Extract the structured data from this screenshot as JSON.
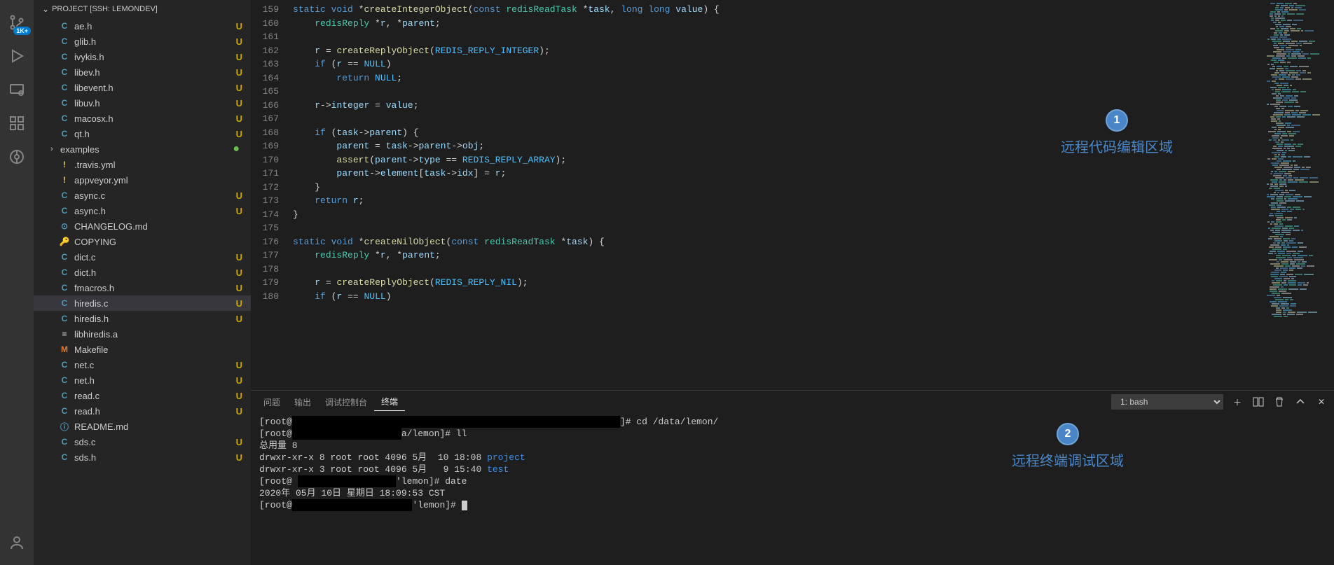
{
  "project_header": "PROJECT [SSH: LEMONDEV]",
  "badge_1k": "1K+",
  "files": [
    {
      "icon": "C",
      "iconClass": "fi-c",
      "name": "ae.h",
      "status": "U"
    },
    {
      "icon": "C",
      "iconClass": "fi-c",
      "name": "glib.h",
      "status": "U"
    },
    {
      "icon": "C",
      "iconClass": "fi-c",
      "name": "ivykis.h",
      "status": "U"
    },
    {
      "icon": "C",
      "iconClass": "fi-c",
      "name": "libev.h",
      "status": "U"
    },
    {
      "icon": "C",
      "iconClass": "fi-c",
      "name": "libevent.h",
      "status": "U"
    },
    {
      "icon": "C",
      "iconClass": "fi-c",
      "name": "libuv.h",
      "status": "U"
    },
    {
      "icon": "C",
      "iconClass": "fi-c",
      "name": "macosx.h",
      "status": "U"
    },
    {
      "icon": "C",
      "iconClass": "fi-c",
      "name": "qt.h",
      "status": "U"
    },
    {
      "icon": ">",
      "iconClass": "chev",
      "name": "examples",
      "dot": "●",
      "folder": true
    },
    {
      "icon": "!",
      "iconClass": "fi-y",
      "name": ".travis.yml"
    },
    {
      "icon": "!",
      "iconClass": "fi-y",
      "name": "appveyor.yml"
    },
    {
      "icon": "C",
      "iconClass": "fi-c",
      "name": "async.c",
      "status": "U"
    },
    {
      "icon": "C",
      "iconClass": "fi-c",
      "name": "async.h",
      "status": "U"
    },
    {
      "icon": "⊙",
      "iconClass": "fi-info",
      "name": "CHANGELOG.md"
    },
    {
      "icon": "🔑",
      "iconClass": "fi-key",
      "name": "COPYING"
    },
    {
      "icon": "C",
      "iconClass": "fi-c",
      "name": "dict.c",
      "status": "U"
    },
    {
      "icon": "C",
      "iconClass": "fi-c",
      "name": "dict.h",
      "status": "U"
    },
    {
      "icon": "C",
      "iconClass": "fi-c",
      "name": "fmacros.h",
      "status": "U"
    },
    {
      "icon": "C",
      "iconClass": "fi-c",
      "name": "hiredis.c",
      "status": "U",
      "active": true
    },
    {
      "icon": "C",
      "iconClass": "fi-c",
      "name": "hiredis.h",
      "status": "U"
    },
    {
      "icon": "≡",
      "iconClass": "fi-lines",
      "name": "libhiredis.a"
    },
    {
      "icon": "M",
      "iconClass": "fi-m",
      "name": "Makefile"
    },
    {
      "icon": "C",
      "iconClass": "fi-c",
      "name": "net.c",
      "status": "U"
    },
    {
      "icon": "C",
      "iconClass": "fi-c",
      "name": "net.h",
      "status": "U"
    },
    {
      "icon": "C",
      "iconClass": "fi-c",
      "name": "read.c",
      "status": "U"
    },
    {
      "icon": "C",
      "iconClass": "fi-c",
      "name": "read.h",
      "status": "U"
    },
    {
      "icon": "ⓘ",
      "iconClass": "fi-info",
      "name": "README.md"
    },
    {
      "icon": "C",
      "iconClass": "fi-c",
      "name": "sds.c",
      "status": "U"
    },
    {
      "icon": "C",
      "iconClass": "fi-c",
      "name": "sds.h",
      "status": "U"
    }
  ],
  "line_start": 159,
  "line_end": 180,
  "code_lines": [
    "<span class='kw'>static</span> <span class='kw'>void</span> <span class='op'>*</span><span class='fn'>createIntegerObject</span><span class='pl'>(</span><span class='kw'>const</span> <span class='ty'>redisReadTask</span> <span class='op'>*</span><span class='va'>task</span><span class='pl'>,</span> <span class='kw'>long</span> <span class='kw'>long</span> <span class='va'>value</span><span class='pl'>) {</span>",
    "    <span class='ty'>redisReply</span> <span class='op'>*</span><span class='va'>r</span><span class='pl'>,</span> <span class='op'>*</span><span class='va'>parent</span><span class='pl'>;</span>",
    "",
    "    <span class='va'>r</span> <span class='op'>=</span> <span class='fn'>createReplyObject</span><span class='pl'>(</span><span class='cn'>REDIS_REPLY_INTEGER</span><span class='pl'>);</span>",
    "    <span class='kw'>if</span> <span class='pl'>(</span><span class='va'>r</span> <span class='op'>==</span> <span class='cn'>NULL</span><span class='pl'>)</span>",
    "        <span class='kw'>return</span> <span class='cn'>NULL</span><span class='pl'>;</span>",
    "",
    "    <span class='va'>r</span><span class='op'>-&gt;</span><span class='va'>integer</span> <span class='op'>=</span> <span class='va'>value</span><span class='pl'>;</span>",
    "",
    "    <span class='kw'>if</span> <span class='pl'>(</span><span class='va'>task</span><span class='op'>-&gt;</span><span class='va'>parent</span><span class='pl'>) {</span>",
    "        <span class='va'>parent</span> <span class='op'>=</span> <span class='va'>task</span><span class='op'>-&gt;</span><span class='va'>parent</span><span class='op'>-&gt;</span><span class='va'>obj</span><span class='pl'>;</span>",
    "        <span class='fn'>assert</span><span class='pl'>(</span><span class='va'>parent</span><span class='op'>-&gt;</span><span class='va'>type</span> <span class='op'>==</span> <span class='cn'>REDIS_REPLY_ARRAY</span><span class='pl'>);</span>",
    "        <span class='va'>parent</span><span class='op'>-&gt;</span><span class='va'>element</span><span class='pl'>[</span><span class='va'>task</span><span class='op'>-&gt;</span><span class='va'>idx</span><span class='pl'>]</span> <span class='op'>=</span> <span class='va'>r</span><span class='pl'>;</span>",
    "    <span class='pl'>}</span>",
    "    <span class='kw'>return</span> <span class='va'>r</span><span class='pl'>;</span>",
    "<span class='pl'>}</span>",
    "",
    "<span class='kw'>static</span> <span class='kw'>void</span> <span class='op'>*</span><span class='fn'>createNilObject</span><span class='pl'>(</span><span class='kw'>const</span> <span class='ty'>redisReadTask</span> <span class='op'>*</span><span class='va'>task</span><span class='pl'>) {</span>",
    "    <span class='ty'>redisReply</span> <span class='op'>*</span><span class='va'>r</span><span class='pl'>,</span> <span class='op'>*</span><span class='va'>parent</span><span class='pl'>;</span>",
    "",
    "    <span class='va'>r</span> <span class='op'>=</span> <span class='fn'>createReplyObject</span><span class='pl'>(</span><span class='cn'>REDIS_REPLY_NIL</span><span class='pl'>);</span>",
    "    <span class='kw'>if</span> <span class='pl'>(</span><span class='va'>r</span> <span class='op'>==</span> <span class='cn'>NULL</span><span class='pl'>)</span>"
  ],
  "annotations": {
    "a1": {
      "num": "1",
      "text": "远程代码编辑区域"
    },
    "a2": {
      "num": "2",
      "text": "远程终端调试区域"
    }
  },
  "panel_tabs": {
    "t0": "问题",
    "t1": "输出",
    "t2": "调试控制台",
    "t3": "终端"
  },
  "terminal_select": "1: bash",
  "terminal_lines": [
    "[root@<span class='redact'>xxxxxxxxxxxxxxxxxxxxxxxxxxxxxxxxxxxxxxxxxxxxxxxxxxxxxxxxxxxx</span>]# cd /data/lemon/",
    "[root@<span class='redact'>xxxxxxxxxxxxxxxxxxxx</span>a/lemon]# ll",
    "总用量 8",
    "drwxr-xr-x 8 root root 4096 5月  10 18:08 <span class='term-dir'>project</span>",
    "drwxr-xr-x 3 root root 4096 5月   9 15:40 <span class='term-dir'>test</span>",
    "[root@ <span class='redact'>xxxxxxxxxxxxxxxxxx</span>'lemon]# date",
    "2020年 05月 10日 星期日 18:09:53 CST",
    "[root@<span class='redact'>xxxxxxxxxxxxxxxxxxxxxx</span>'lemon]# <span class='term-cursor'></span>"
  ]
}
